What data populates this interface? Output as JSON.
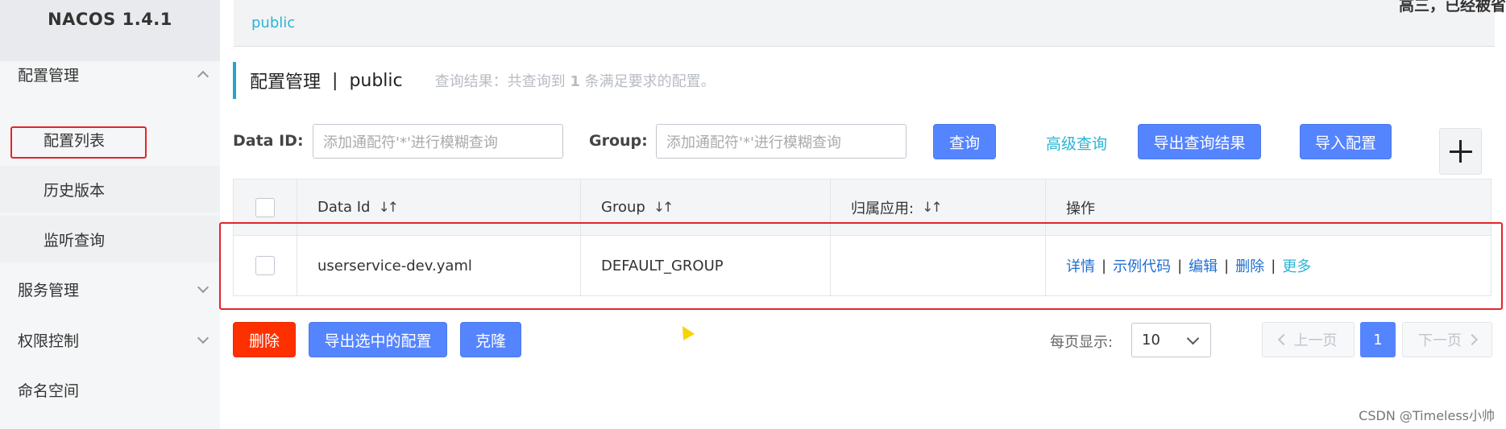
{
  "app": {
    "brand": "NACOS 1.4.1"
  },
  "sidebar": {
    "items": [
      {
        "label": "配置管理",
        "expanded": true
      },
      {
        "label": "服务管理",
        "expanded": false
      },
      {
        "label": "权限控制",
        "expanded": false
      },
      {
        "label": "命名空间"
      }
    ],
    "sub_items": [
      {
        "label": "配置列表",
        "active": true
      },
      {
        "label": "历史版本"
      },
      {
        "label": "监听查询"
      }
    ]
  },
  "topbar": {
    "namespace_tab": "public",
    "corner_text": "高三，已经被省"
  },
  "header": {
    "title": "配置管理",
    "separator": "|",
    "namespace": "public",
    "summary_prefix": "查询结果：共查询到",
    "summary_count": "1",
    "summary_suffix": "条满足要求的配置。"
  },
  "filters": {
    "data_id_label": "Data ID:",
    "data_id_placeholder": "添加通配符'*'进行模糊查询",
    "group_label": "Group:",
    "group_placeholder": "添加通配符'*'进行模糊查询",
    "query_button": "查询",
    "advanced_query": "高级查询",
    "export_results": "导出查询结果",
    "import_config": "导入配置"
  },
  "table": {
    "columns": [
      "Data Id",
      "Group",
      "归属应用:",
      "操作"
    ],
    "rows": [
      {
        "data_id": "userservice-dev.yaml",
        "group": "DEFAULT_GROUP",
        "app": "",
        "actions": [
          "详情",
          "示例代码",
          "编辑",
          "删除",
          "更多"
        ]
      }
    ]
  },
  "bulk_actions": {
    "delete": "删除",
    "export_selected": "导出选中的配置",
    "clone": "克隆"
  },
  "pagination": {
    "page_size_label": "每页显示:",
    "page_size": "10",
    "prev": "上一页",
    "current_page": "1",
    "next": "下一页"
  },
  "watermark": "CSDN @Timeless小帅",
  "colors": {
    "primary": "#5584ff",
    "danger": "#ff3000",
    "link": "#2bb4d4",
    "highlight_box": "#e6232b"
  }
}
